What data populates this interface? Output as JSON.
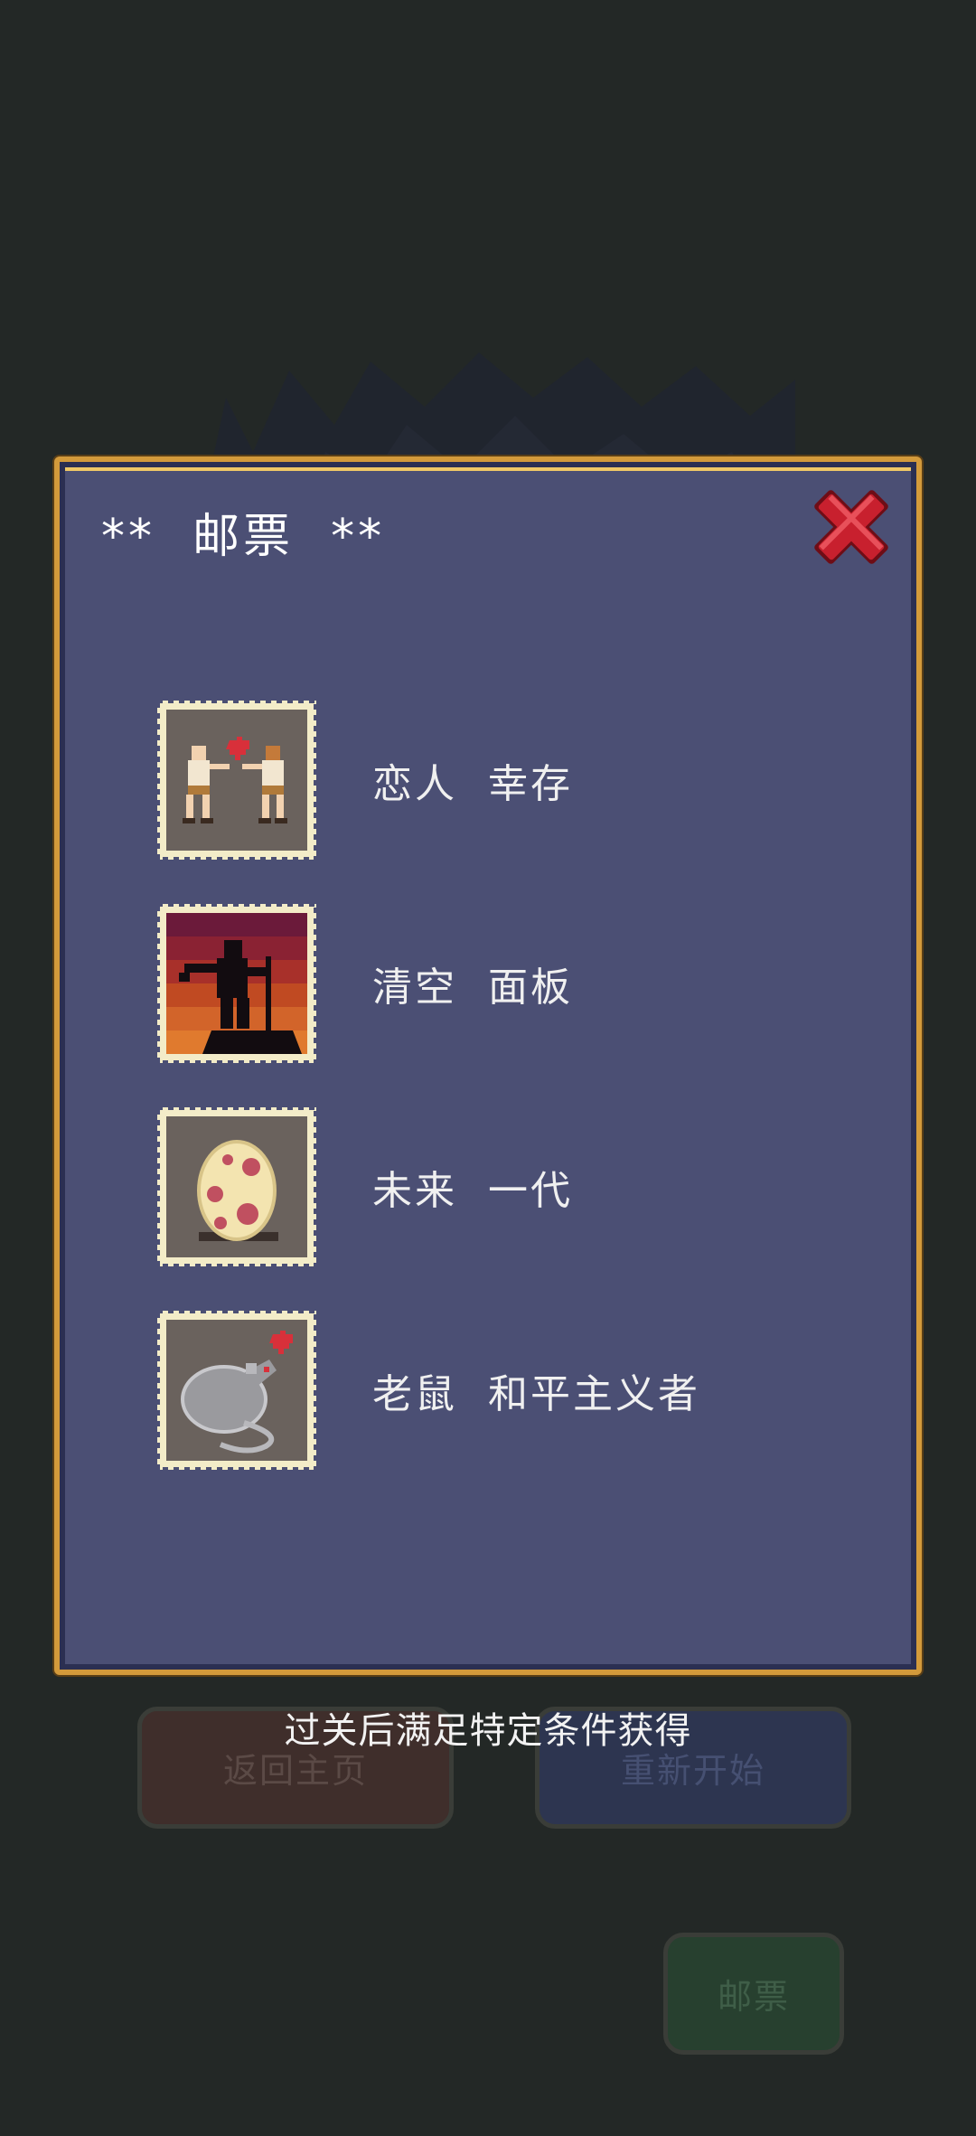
{
  "dialog": {
    "title": "**  邮票  **"
  },
  "stamps": [
    {
      "label": "恋人  幸存",
      "icon": "lovers-stamp-icon"
    },
    {
      "label": "清空  面板",
      "icon": "silhouette-sword-stamp-icon"
    },
    {
      "label": "未来  一代",
      "icon": "spotted-egg-stamp-icon"
    },
    {
      "label": "老鼠  和平主义者",
      "icon": "rat-heart-stamp-icon"
    }
  ],
  "hint": "过关后满足特定条件获得",
  "background_buttons": {
    "home": "返回主页",
    "restart": "重新开始",
    "stamps": "邮票"
  },
  "colors": {
    "background": "#232826",
    "dialog_fill": "#4b4f74",
    "dialog_border": "#d39a3b",
    "close_red": "#c8202e"
  }
}
